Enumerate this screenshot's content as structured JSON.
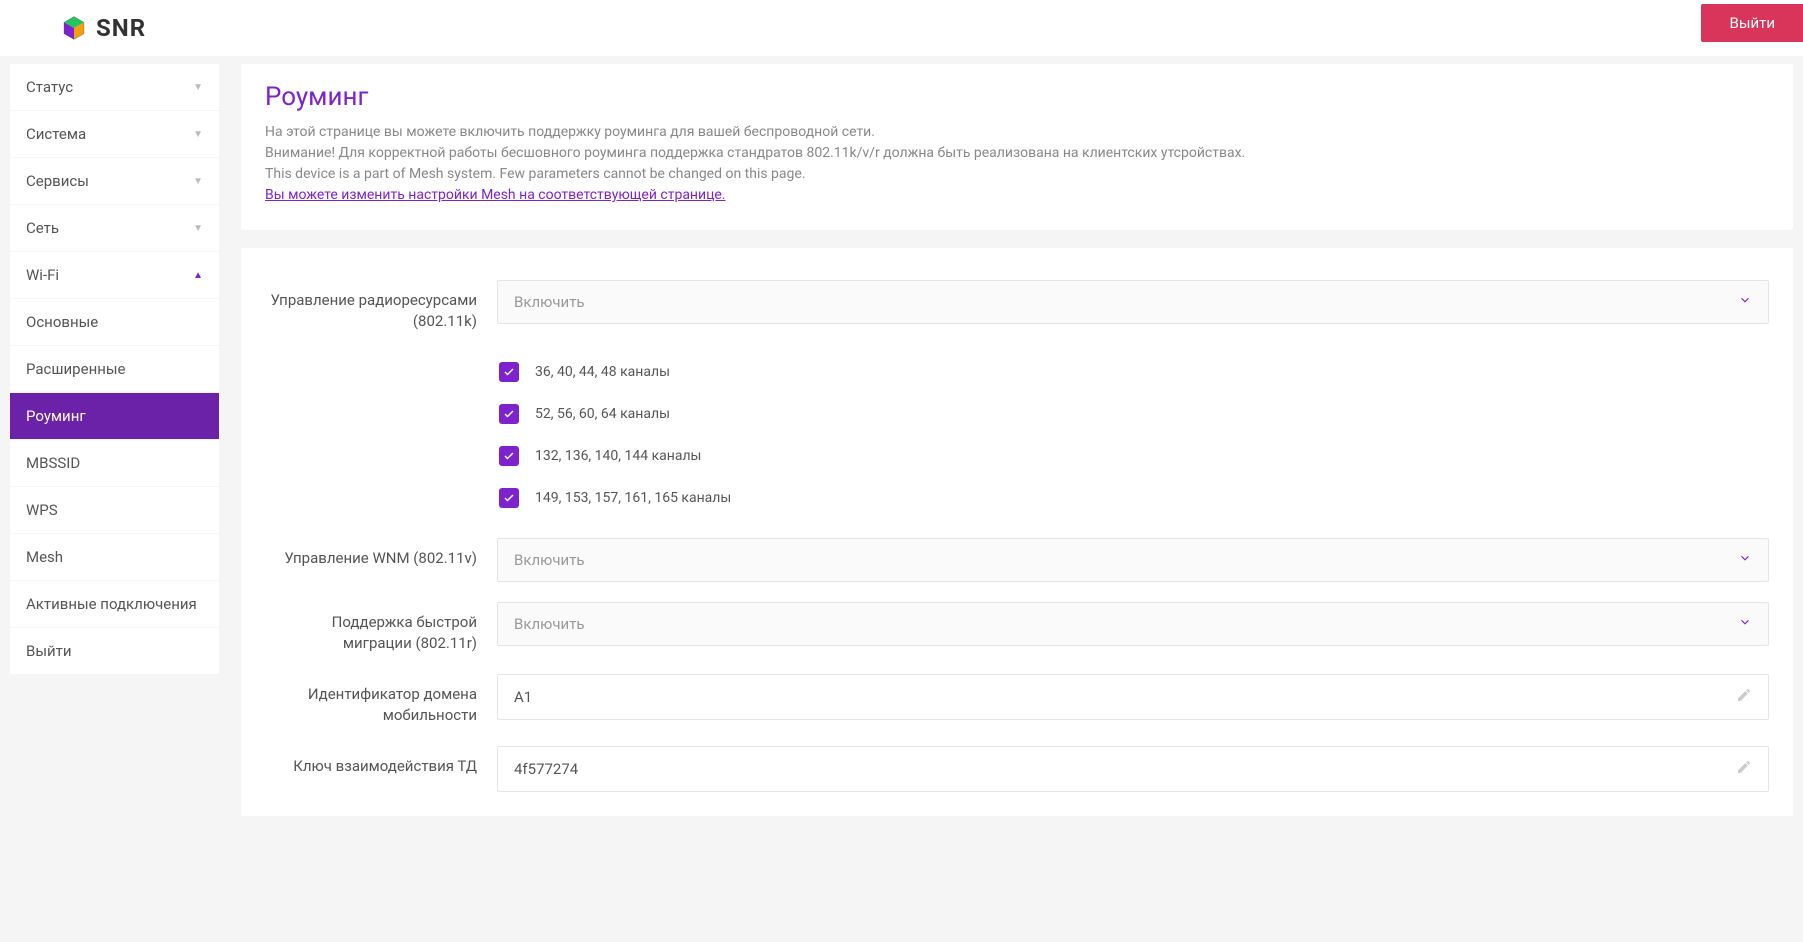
{
  "header": {
    "brand": "SNR",
    "logout": "Выйти"
  },
  "sidebar": {
    "items": [
      {
        "label": "Статус",
        "type": "parent",
        "expanded": false
      },
      {
        "label": "Система",
        "type": "parent",
        "expanded": false
      },
      {
        "label": "Сервисы",
        "type": "parent",
        "expanded": false
      },
      {
        "label": "Сеть",
        "type": "parent",
        "expanded": false
      },
      {
        "label": "Wi-Fi",
        "type": "parent",
        "expanded": true
      },
      {
        "label": "Основные",
        "type": "sub"
      },
      {
        "label": "Расширенные",
        "type": "sub"
      },
      {
        "label": "Роуминг",
        "type": "sub",
        "active": true
      },
      {
        "label": "MBSSID",
        "type": "sub"
      },
      {
        "label": "WPS",
        "type": "sub"
      },
      {
        "label": "Mesh",
        "type": "sub"
      },
      {
        "label": "Активные подключения",
        "type": "sub"
      },
      {
        "label": "Выйти",
        "type": "sub"
      }
    ]
  },
  "page": {
    "title": "Роуминг",
    "desc1": "На этой странице вы можете включить поддержку роуминга для вашей беспроводной сети.",
    "desc2": "Внимание! Для корректной работы бесшовного роуминга поддержка стандратов 802.11k/v/r должна быть реализована на клиентских утсройствах.",
    "desc3": "This device is a part of Mesh system. Few parameters cannot be changed on this page.",
    "desc_link": "Вы можете изменить настройки Mesh на соответствующей странице."
  },
  "form": {
    "rrm_label": "Управление радиоресурсами (802.11k)",
    "rrm_value": "Включить",
    "channels": [
      {
        "label": "36, 40, 44, 48 каналы",
        "checked": true
      },
      {
        "label": "52, 56, 60, 64 каналы",
        "checked": true
      },
      {
        "label": "132, 136, 140, 144 каналы",
        "checked": true
      },
      {
        "label": "149, 153, 157, 161, 165 каналы",
        "checked": true
      }
    ],
    "wnm_label": "Управление WNM (802.11v)",
    "wnm_value": "Включить",
    "ft_label": "Поддержка быстрой миграции (802.11r)",
    "ft_value": "Включить",
    "domain_label": "Идентификатор домена мобильности",
    "domain_value": "A1",
    "key_label": "Ключ взаимодействия ТД",
    "key_value": "4f577274"
  }
}
